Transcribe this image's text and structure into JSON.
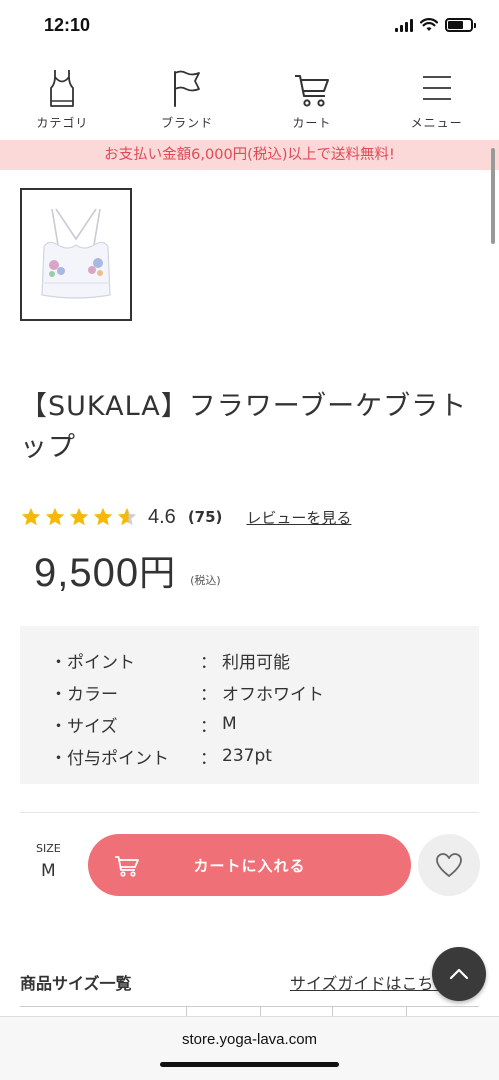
{
  "status_bar": {
    "time": "12:10"
  },
  "nav": {
    "items": [
      {
        "label": "カテゴリ",
        "icon": "tank-top-icon"
      },
      {
        "label": "ブランド",
        "icon": "flag-icon"
      },
      {
        "label": "カート",
        "icon": "cart-icon"
      },
      {
        "label": "メニュー",
        "icon": "menu-icon"
      }
    ]
  },
  "promo": {
    "text": "お支払い金額6,000円(税込)以上で送料無料!"
  },
  "product": {
    "title": "【SUKALA】フラワーブーケブラトップ",
    "rating": 4.6,
    "rating_text": "4.6",
    "review_count": "(75)",
    "review_link": "レビューを見る",
    "price": "9,500",
    "currency": "円",
    "tax_note": "(税込)"
  },
  "info": {
    "rows": [
      {
        "label": "・ポイント",
        "colon": "：",
        "value": "利用可能"
      },
      {
        "label": "・カラー",
        "colon": "：",
        "value": "オフホワイト"
      },
      {
        "label": "・サイズ",
        "colon": "：",
        "value": "M"
      },
      {
        "label": "・付与ポイント",
        "colon": "：",
        "value": "237pt"
      }
    ]
  },
  "purchase": {
    "size_label": "SIZE",
    "size_value": "M",
    "cart_button": "カートに入れる"
  },
  "size_table": {
    "title": "商品サイズ一覧",
    "guide_link": "サイズガイドはこちら"
  },
  "browser": {
    "url": "store.yoga-lava.com"
  },
  "colors": {
    "accent": "#f07077",
    "promo_bg": "#fbd9d9",
    "promo_text": "#e14a55",
    "star": "#f5b90b"
  }
}
